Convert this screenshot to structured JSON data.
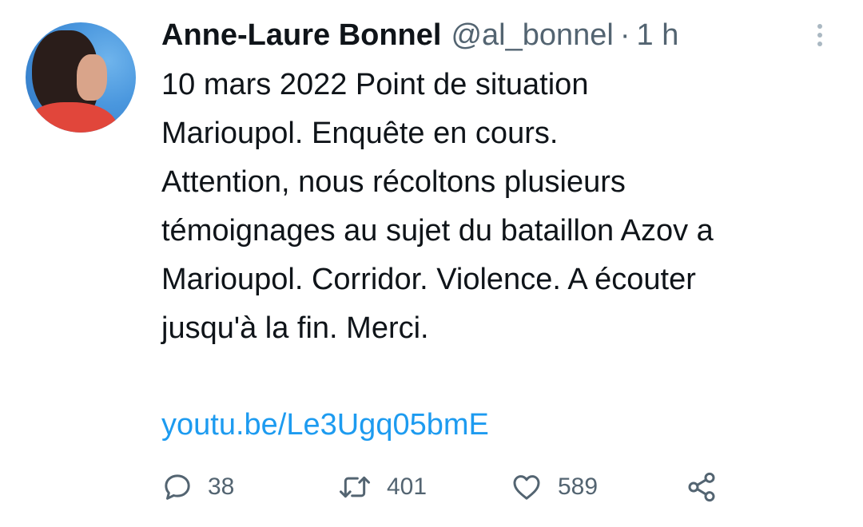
{
  "author": {
    "name": "Anne-Laure Bonnel",
    "handle": "@al_bonnel",
    "separator": "·",
    "time": "1 h"
  },
  "tweet": {
    "text": "10 mars 2022  Point de situation\nMarioupol. Enquête en cours.\nAttention, nous récoltons plusieurs\ntémoignages au sujet du bataillon Azov a\nMarioupol. Corridor. Violence.  A écouter\njusqu'à la fin. Merci.",
    "link": "youtu.be/Le3Ugq05bmE"
  },
  "actions": {
    "replies": "38",
    "retweets": "401",
    "likes": "589"
  },
  "colors": {
    "text": "#0f1419",
    "muted": "#536471",
    "link": "#1d9bf0"
  },
  "icons": {
    "reply": "reply-icon",
    "retweet": "retweet-icon",
    "like": "heart-icon",
    "share": "share-icon",
    "more": "more-vertical-icon"
  }
}
